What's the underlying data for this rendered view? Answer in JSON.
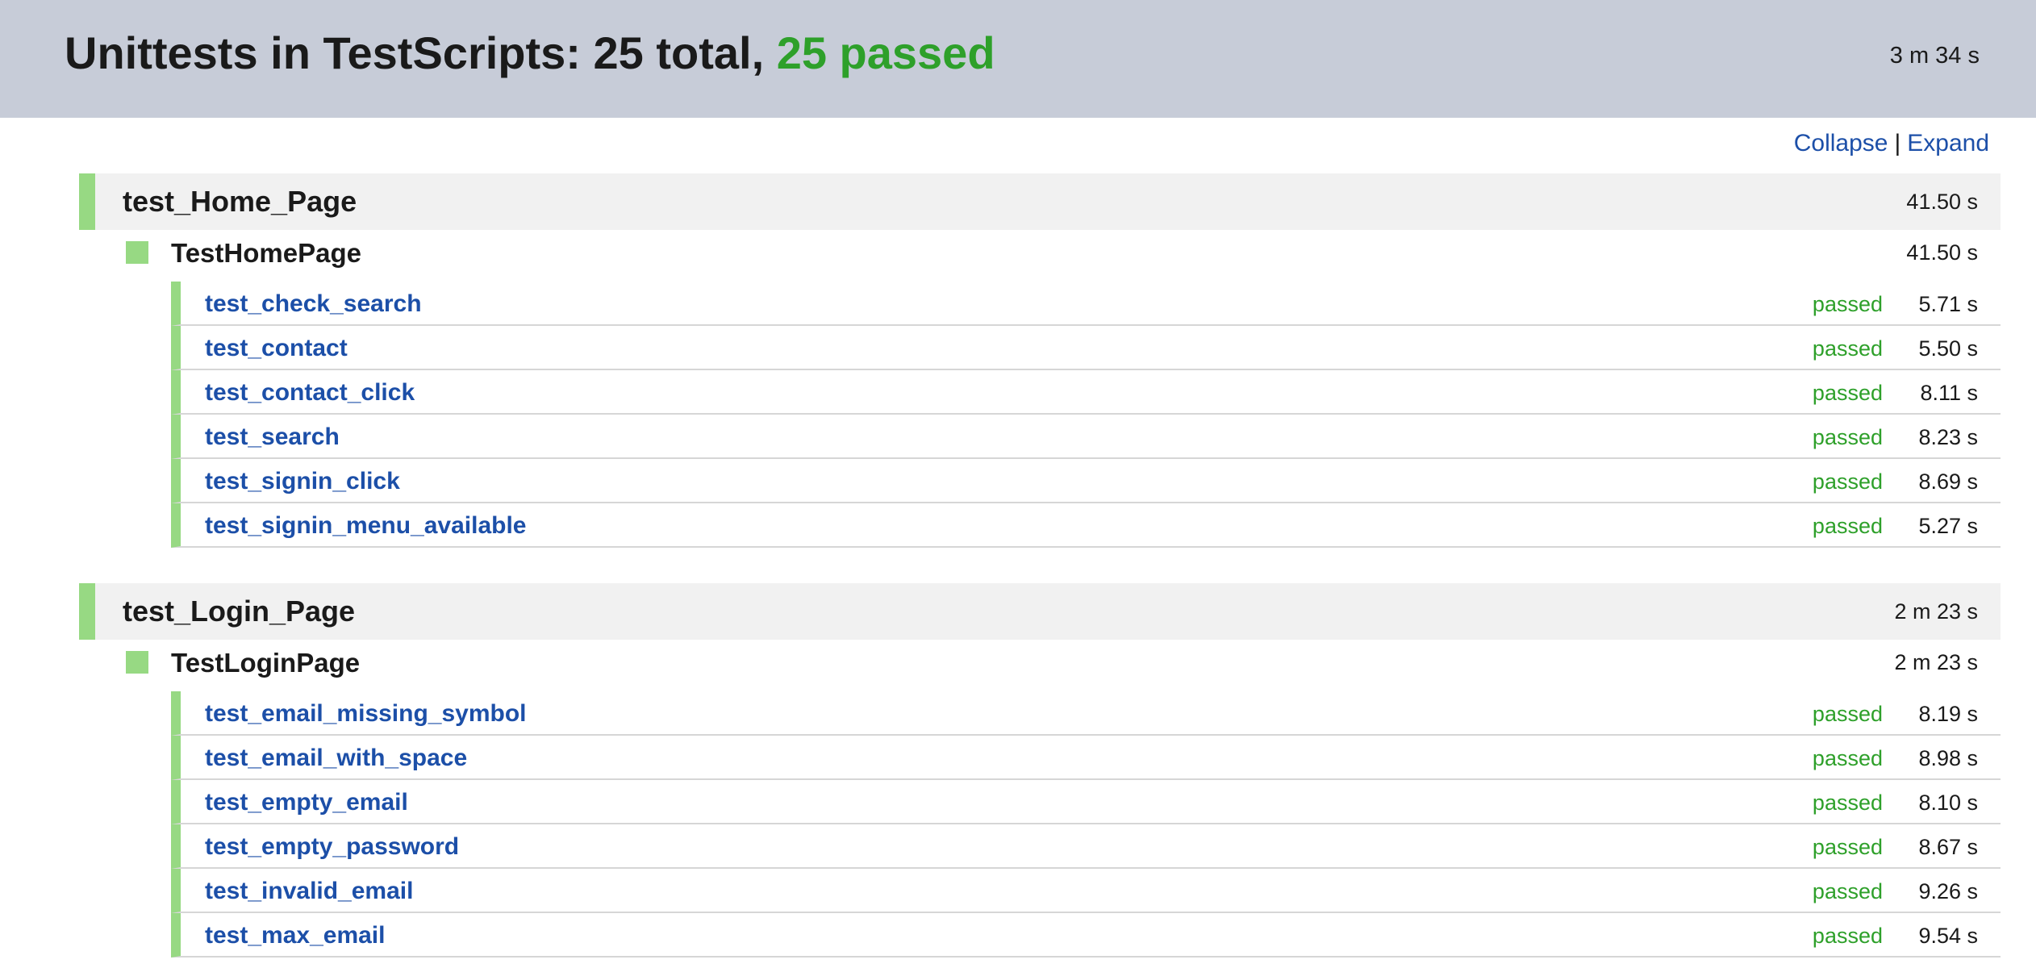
{
  "header": {
    "title_prefix": "Unittests in TestScripts: 25 total, ",
    "title_passed": "25 passed",
    "duration": "3 m 34 s"
  },
  "controls": {
    "collapse_label": "Collapse",
    "separator": "|",
    "expand_label": "Expand"
  },
  "colors": {
    "header_bg": "#c7ccd8",
    "pass_green": "#2ea02a",
    "bar_green": "#97d983",
    "link_blue": "#1c4fa8"
  },
  "suites": [
    {
      "module": "test_Home_Page",
      "module_time": "41.50 s",
      "class_name": "TestHomePage",
      "class_time": "41.50 s",
      "tests": [
        {
          "name": "test_check_search",
          "status": "passed",
          "time": "5.71 s"
        },
        {
          "name": "test_contact",
          "status": "passed",
          "time": "5.50 s"
        },
        {
          "name": "test_contact_click",
          "status": "passed",
          "time": "8.11 s"
        },
        {
          "name": "test_search",
          "status": "passed",
          "time": "8.23 s"
        },
        {
          "name": "test_signin_click",
          "status": "passed",
          "time": "8.69 s"
        },
        {
          "name": "test_signin_menu_available",
          "status": "passed",
          "time": "5.27 s"
        }
      ]
    },
    {
      "module": "test_Login_Page",
      "module_time": "2 m 23 s",
      "class_name": "TestLoginPage",
      "class_time": "2 m 23 s",
      "tests": [
        {
          "name": "test_email_missing_symbol",
          "status": "passed",
          "time": "8.19 s"
        },
        {
          "name": "test_email_with_space",
          "status": "passed",
          "time": "8.98 s"
        },
        {
          "name": "test_empty_email",
          "status": "passed",
          "time": "8.10 s"
        },
        {
          "name": "test_empty_password",
          "status": "passed",
          "time": "8.67 s"
        },
        {
          "name": "test_invalid_email",
          "status": "passed",
          "time": "9.26 s"
        },
        {
          "name": "test_max_email",
          "status": "passed",
          "time": "9.54 s"
        }
      ]
    }
  ]
}
